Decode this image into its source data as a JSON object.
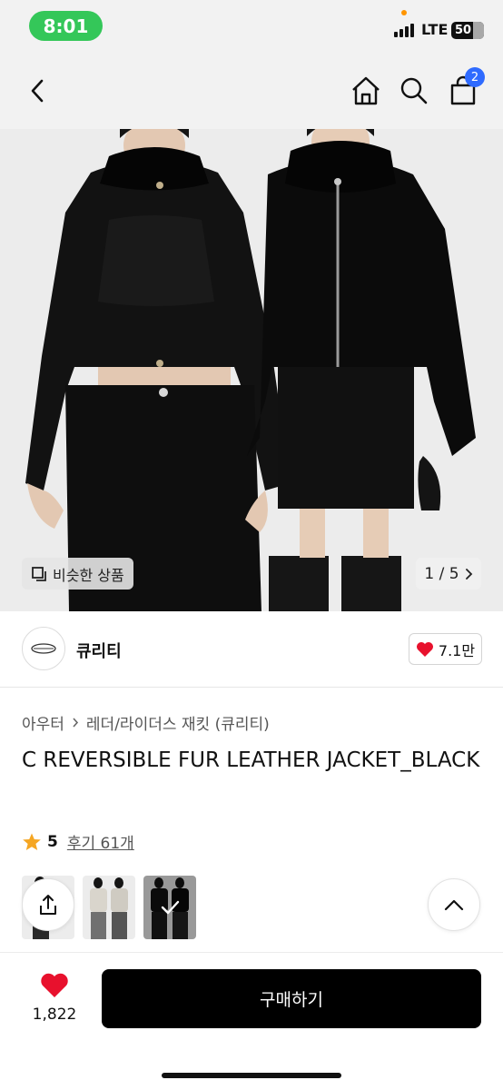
{
  "status_bar": {
    "time": "8:01",
    "network": "LTE",
    "battery": "50"
  },
  "nav": {
    "back_icon": "back-icon",
    "home_icon": "home-icon",
    "search_icon": "search-icon",
    "cart_icon": "cart-icon",
    "cart_count": "2"
  },
  "hero": {
    "similar_label": "비슷한 상품",
    "pager": "1 / 5"
  },
  "store": {
    "name": "큐리티",
    "like_count": "7.1만"
  },
  "breadcrumb": {
    "level1": "아우터",
    "level2": "레더/라이더스 재킷 (큐리티)"
  },
  "product": {
    "title": "C REVERSIBLE FUR LEATHER JACKET_BLACK",
    "rating": "5",
    "reviews": "후기 61개"
  },
  "bottom": {
    "wish_count": "1,822",
    "buy_label": "구매하기"
  },
  "colors": {
    "accent_blue": "#2f6bff",
    "heart_red": "#e8112d",
    "star": "#f5a623",
    "status_green": "#34c759"
  }
}
